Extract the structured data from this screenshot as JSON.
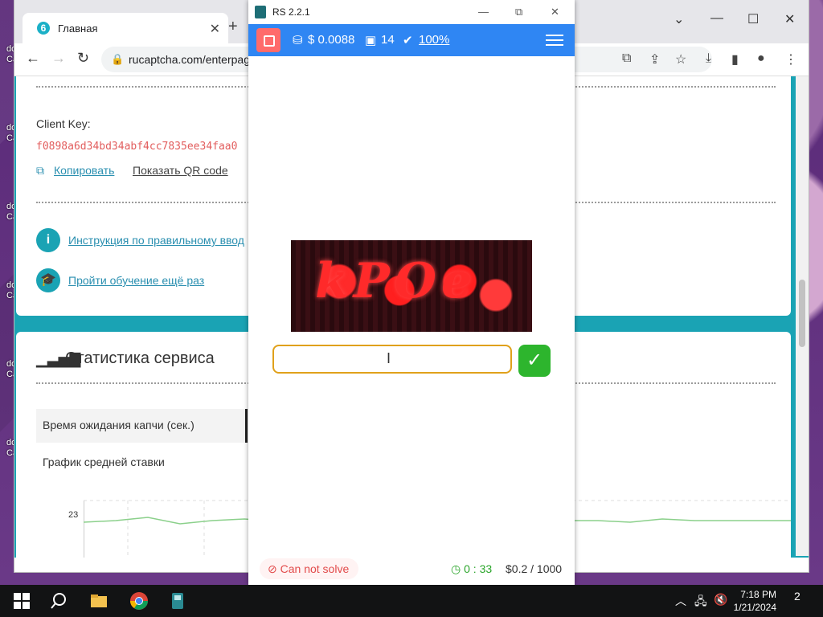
{
  "desktop": {
    "icon_labels": [
      "do\nCa",
      "do\nCa",
      "do\nCa",
      "do\nCa",
      "do\nCa",
      "do\nCa"
    ]
  },
  "browser": {
    "tab_title": "Главная",
    "url": "rucaptcha.com/enterpag",
    "client_key_label": "Client Key:",
    "client_key_value": "f0898a6d34bd34abf4cc7835ee34faa0",
    "copy_link": "Копировать",
    "qr_link": "Показать QR code",
    "instruction_link": "Инструкция по правильному ввод",
    "training_link": "Пройти обучение ещё раз",
    "stats_title": "Статистика сервиса",
    "stats_item": "Время ожидания капчи (сек.)",
    "chart_title": "График средней ставки",
    "chart_tick": "23",
    "colors": {
      "accent": "#1aa3b4",
      "key": "#e25d5d",
      "link": "#2a8fb0"
    }
  },
  "rs": {
    "window_title": "RS 2.2.1",
    "balance": "$ 0.0088",
    "images": "14",
    "rating": "100%",
    "captcha_text": "kPOe",
    "answer_placeholder": "",
    "cannot_solve": "Can not solve",
    "timer": "0 : 33",
    "price": "$0.2 / 1000",
    "colors": {
      "header": "#2f86f3",
      "stop": "#ff6b6b",
      "ok": "#2db52d",
      "input_border": "#e0a11b"
    }
  },
  "taskbar": {
    "time": "7:18 PM",
    "date": "1/21/2024",
    "notifications": "2"
  }
}
